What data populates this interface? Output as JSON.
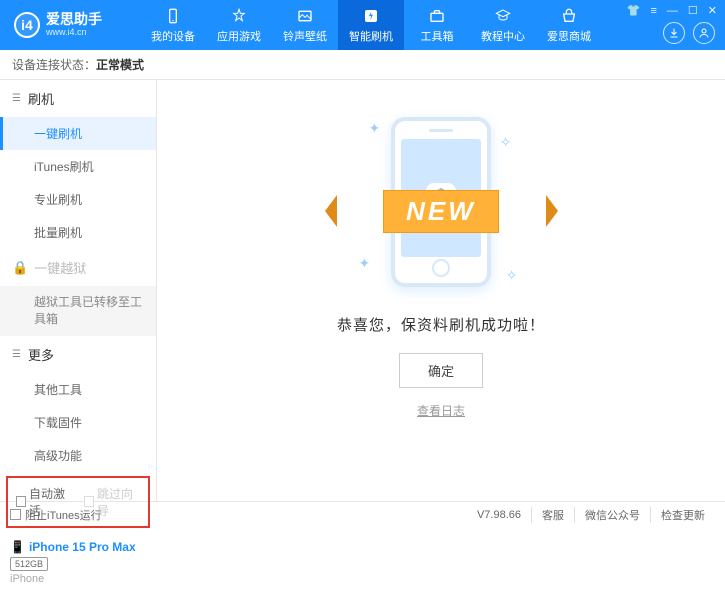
{
  "app": {
    "title": "爱思助手",
    "url": "www.i4.cn"
  },
  "topnav": [
    {
      "label": "我的设备"
    },
    {
      "label": "应用游戏"
    },
    {
      "label": "铃声壁纸"
    },
    {
      "label": "智能刷机",
      "active": true
    },
    {
      "label": "工具箱"
    },
    {
      "label": "教程中心"
    },
    {
      "label": "爱思商城"
    }
  ],
  "status": {
    "prefix": "设备连接状态：",
    "value": "正常模式"
  },
  "sidebar": {
    "flash_group": "刷机",
    "items_flash": [
      "一键刷机",
      "iTunes刷机",
      "专业刷机",
      "批量刷机"
    ],
    "jailbreak_group": "一键越狱",
    "jailbreak_note": "越狱工具已转移至工具箱",
    "more_group": "更多",
    "items_more": [
      "其他工具",
      "下载固件",
      "高级功能"
    ],
    "checkboxes": {
      "auto_activate": "自动激活",
      "skip_setup": "跳过向导"
    }
  },
  "device": {
    "name": "iPhone 15 Pro Max",
    "storage": "512GB",
    "type": "iPhone"
  },
  "main": {
    "ribbon": "NEW",
    "message": "恭喜您，保资料刷机成功啦！",
    "ok": "确定",
    "view_log": "查看日志"
  },
  "footer": {
    "block_itunes": "阻止iTunes运行",
    "version": "V7.98.66",
    "links": [
      "客服",
      "微信公众号",
      "检查更新"
    ]
  }
}
